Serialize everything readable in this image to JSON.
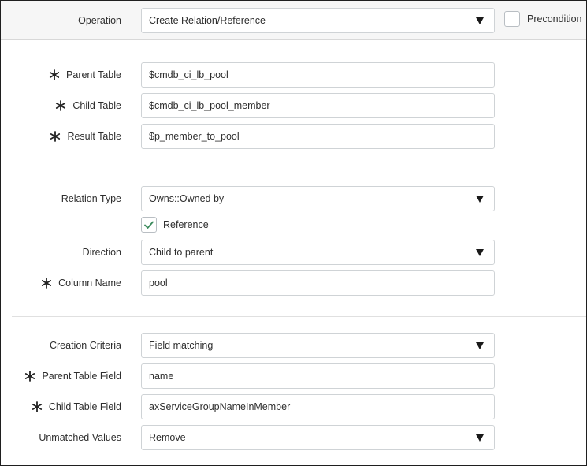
{
  "operation": {
    "label": "Operation",
    "value": "Create Relation/Reference",
    "precondition_label": "Precondition",
    "precondition_checked": false
  },
  "tables": {
    "parent_table": {
      "label": "Parent Table",
      "value": "$cmdb_ci_lb_pool",
      "required": true
    },
    "child_table": {
      "label": "Child Table",
      "value": "$cmdb_ci_lb_pool_member",
      "required": true
    },
    "result_table": {
      "label": "Result Table",
      "value": "$p_member_to_pool",
      "required": true
    }
  },
  "relation": {
    "relation_type": {
      "label": "Relation Type",
      "value": "Owns::Owned by"
    },
    "reference": {
      "label": "Reference",
      "checked": true
    },
    "direction": {
      "label": "Direction",
      "value": "Child to parent"
    },
    "column_name": {
      "label": "Column Name",
      "value": "pool",
      "required": true
    }
  },
  "criteria": {
    "creation_criteria": {
      "label": "Creation Criteria",
      "value": "Field matching"
    },
    "parent_table_field": {
      "label": "Parent Table Field",
      "value": "name",
      "required": true
    },
    "child_table_field": {
      "label": "Child Table Field",
      "value": "axServiceGroupNameInMember",
      "required": true
    },
    "unmatched_values": {
      "label": "Unmatched Values",
      "value": "Remove"
    }
  },
  "icons": {
    "required": "asterisk-icon",
    "dropdown": "caret-down-icon",
    "check": "checkmark-icon"
  },
  "colors": {
    "check": "#3a8a5c",
    "field_border": "#cfd3d6",
    "header_bg": "#f6f6f6"
  }
}
